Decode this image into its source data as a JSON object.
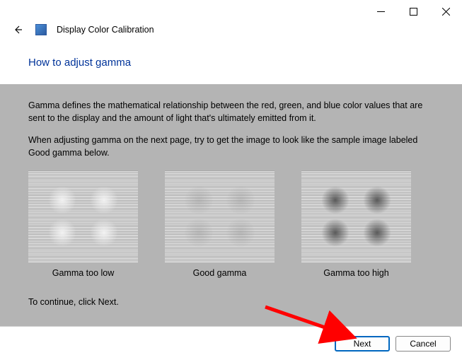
{
  "window": {
    "app_title": "Display Color Calibration"
  },
  "heading": "How to adjust gamma",
  "body": {
    "para1": "Gamma defines the mathematical relationship between the red, green, and blue color values that are sent to the display and the amount of light that's ultimately emitted from it.",
    "para2": "When adjusting gamma on the next page, try to get the image to look like the sample image labeled Good gamma below.",
    "samples": {
      "low": "Gamma too low",
      "good": "Good gamma",
      "high": "Gamma too high"
    },
    "continue": "To continue, click Next."
  },
  "buttons": {
    "next": "Next",
    "cancel": "Cancel"
  }
}
